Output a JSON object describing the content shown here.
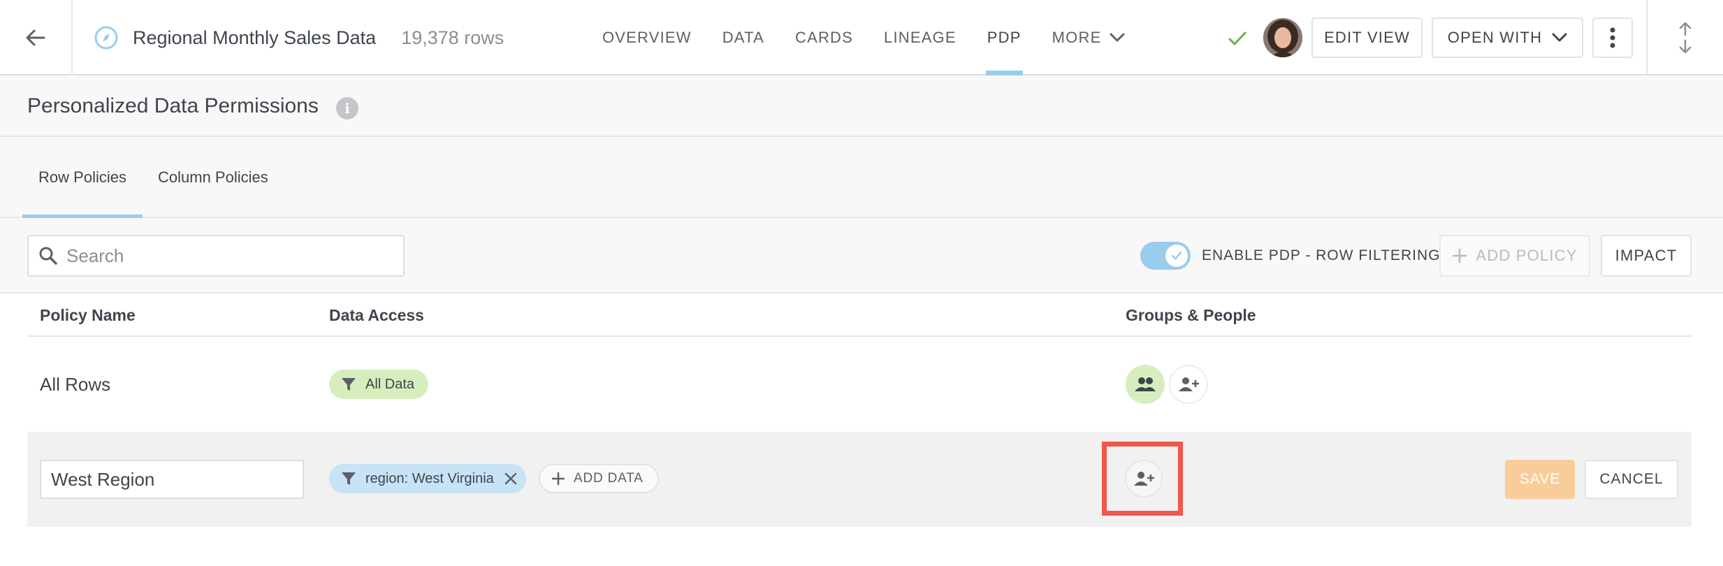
{
  "header": {
    "dataset_title": "Regional Monthly Sales Data",
    "row_count": "19,378 rows",
    "nav": [
      {
        "label": "OVERVIEW"
      },
      {
        "label": "DATA"
      },
      {
        "label": "CARDS"
      },
      {
        "label": "LINEAGE"
      },
      {
        "label": "PDP",
        "active": true
      },
      {
        "label": "MORE"
      }
    ],
    "edit_view_label": "EDIT VIEW",
    "open_with_label": "OPEN WITH",
    "icons": {
      "back": "arrow-left-icon",
      "dataset": "compass-icon",
      "status": "checkmark-icon",
      "menu": "kebab-menu-icon",
      "resize": "vertical-arrows-icon"
    }
  },
  "section": {
    "title": "Personalized Data Permissions",
    "info_icon": "i"
  },
  "tabs": [
    {
      "label": "Row Policies",
      "active": true
    },
    {
      "label": "Column Policies",
      "active": false
    }
  ],
  "toolbar": {
    "search_placeholder": "Search",
    "toggle_label": "ENABLE PDP - ROW FILTERING",
    "toggle_on": true,
    "add_policy_label": "ADD POLICY",
    "impact_label": "IMPACT"
  },
  "table": {
    "columns": [
      "Policy Name",
      "Data Access",
      "Groups & People"
    ],
    "rows": [
      {
        "name": "All Rows",
        "data_access": "All Data"
      },
      {
        "name_value": "West Region",
        "filter": "region: West Virginia",
        "add_data_label": "ADD DATA",
        "save_label": "SAVE",
        "cancel_label": "CANCEL"
      }
    ]
  },
  "colors": {
    "accent_blue": "#99ccee",
    "filter_green": "#d6eebd",
    "filter_blue": "#c7e3f6",
    "save_orange": "#f9cd9a",
    "highlight_red": "#f0564a",
    "check_green": "#6ab04c"
  }
}
